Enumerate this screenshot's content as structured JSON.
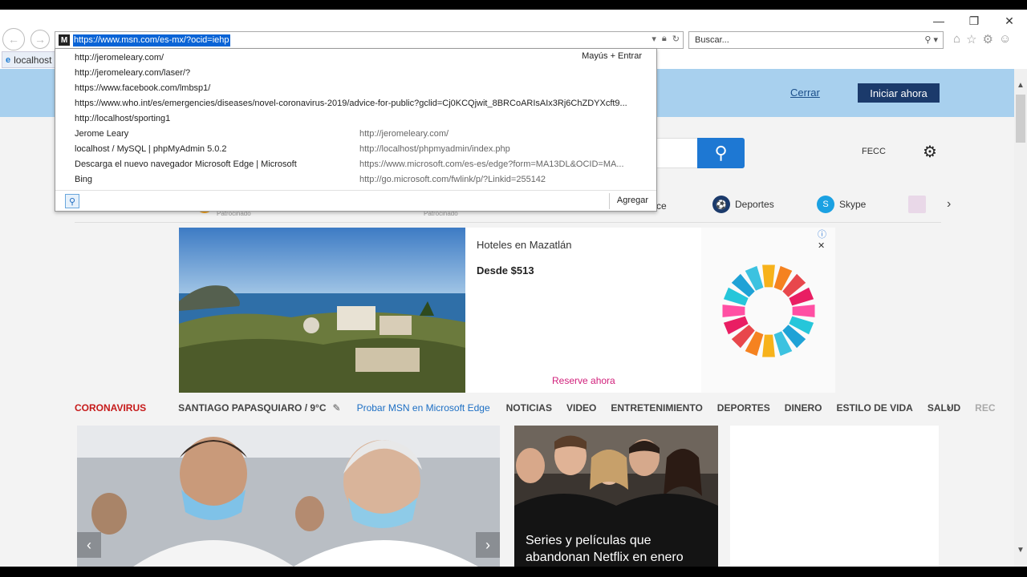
{
  "browser": {
    "address_url": "https://www.msn.com/es-mx/?ocid=iehp",
    "search_placeholder": "Buscar...",
    "tab_label": "localhost",
    "favicon_glyph": "e",
    "site_icon_glyph": "M"
  },
  "autocomplete": {
    "shortcut_hint": "Mayús + Entrar",
    "history": [
      "http://jeromeleary.com/",
      "http://jeromeleary.com/laser/?",
      "https://www.facebook.com/lmbsp1/",
      "https://www.who.int/es/emergencies/diseases/novel-coronavirus-2019/advice-for-public?gclid=Cj0KCQjwit_8BRCoARIsAIx3Rj6ChZDYXcft9...",
      "http://localhost/sporting1"
    ],
    "favorites": [
      {
        "title": "Jerome Leary",
        "url": "http://jeromeleary.com/"
      },
      {
        "title": "localhost / MySQL | phpMyAdmin 5.0.2",
        "url": "http://localhost/phpmyadmin/index.php"
      },
      {
        "title": "Descarga el nuevo navegador Microsoft Edge | Microsoft",
        "url": "https://www.microsoft.com/es-es/edge?form=MA13DL&OCID=MA..."
      },
      {
        "title": "Bing",
        "url": "http://go.microsoft.com/fwlink/p/?Linkid=255142"
      }
    ],
    "add_label": "Agregar"
  },
  "banner": {
    "close_label": "Cerrar",
    "start_label": "Iniciar ahora"
  },
  "header": {
    "user_label": "FECC"
  },
  "quicklinks": {
    "sponsored_1": "Patrocinado",
    "sponsored_2": "Patrocinado",
    "partial_label": "ce",
    "sports": "Deportes",
    "skype": "Skype"
  },
  "ad": {
    "title": "Hoteles en Mazatlán",
    "price": "Desde $513",
    "cta": "Reserve ahora",
    "colors": [
      "#f7b21b",
      "#f58220",
      "#e8474c",
      "#e91e63",
      "#ff4fa3",
      "#26c6da",
      "#1fa2d6",
      "#3cc2e0"
    ]
  },
  "catnav": {
    "coronavirus": "CORONAVIRUS",
    "weather": "SANTIAGO PAPASQUIARO / 9°C",
    "edge_promo": "Probar MSN en Microsoft Edge",
    "categories": [
      "NOTICIAS",
      "VIDEO",
      "ENTRETENIMIENTO",
      "DEPORTES",
      "DINERO",
      "ESTILO DE VIDA",
      "SALUD"
    ],
    "faded": "REC"
  },
  "cards": {
    "card2_caption": "Series y películas que abandonan Netflix en enero"
  }
}
